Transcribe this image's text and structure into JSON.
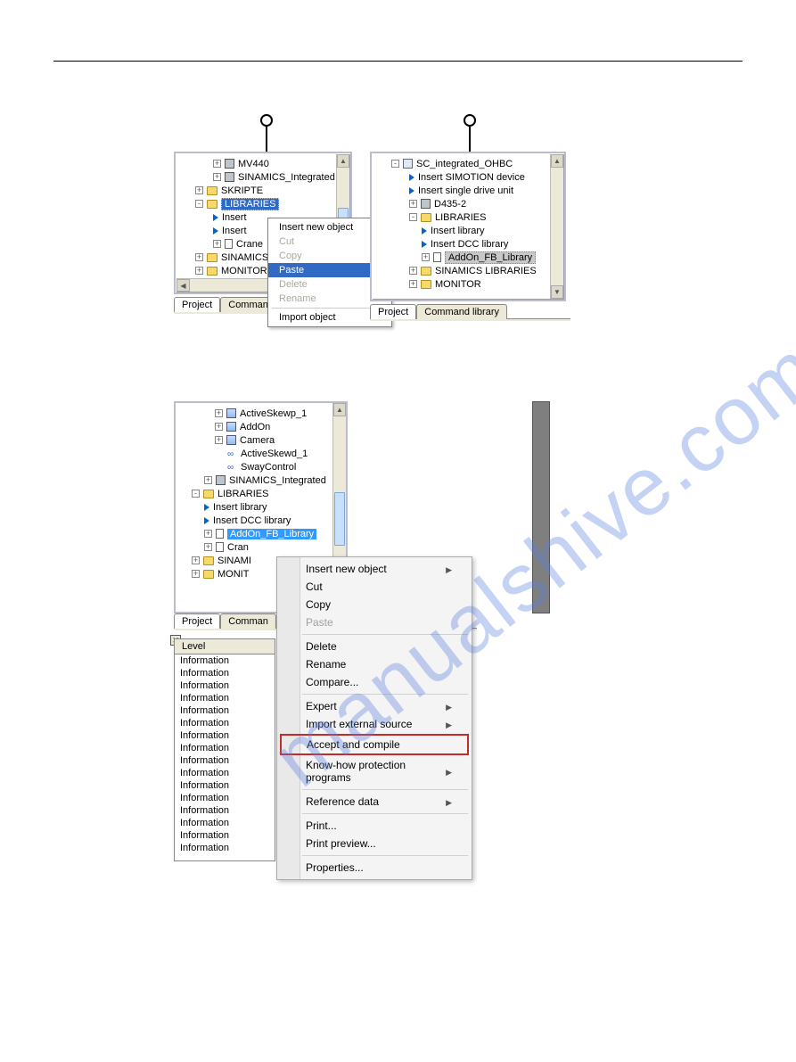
{
  "watermark": "manualshive.com",
  "panelA": {
    "tree": {
      "mv440": "MV440",
      "sinamics_int": "SINAMICS_Integrated",
      "skripte": "SKRIPTE",
      "libraries": "LIBRARIES",
      "insert1": "Insert",
      "insert2": "Insert",
      "crane": "Crane",
      "sinamics": "SINAMICS",
      "monitor": "MONITOR"
    },
    "tabs": {
      "project": "Project",
      "cmdlib": "Command lib"
    },
    "menu": {
      "insert_new": "Insert new object",
      "cut": "Cut",
      "copy": "Copy",
      "paste": "Paste",
      "delete": "Delete",
      "rename": "Rename",
      "import": "Import object"
    }
  },
  "panelB": {
    "tree": {
      "root": "SC_integrated_OHBC",
      "ins_simotion": "Insert SIMOTION device",
      "ins_drive": "Insert single drive unit",
      "d435": "D435-2",
      "libraries": "LIBRARIES",
      "ins_lib": "Insert library",
      "ins_dcc": "Insert DCC library",
      "addon": "AddOn_FB_Library",
      "sinamics_lib": "SINAMICS LIBRARIES",
      "monitor": "MONITOR"
    },
    "tabs": {
      "project": "Project",
      "cmdlib": "Command library"
    }
  },
  "panelC": {
    "tree": {
      "askewp1": "ActiveSkewp_1",
      "addon": "AddOn",
      "camera": "Camera",
      "askewd1": "ActiveSkewd_1",
      "swayc": "SwayControl",
      "sinamics_int": "SINAMICS_Integrated",
      "libraries": "LIBRARIES",
      "ins_lib": "Insert library",
      "ins_dcc": "Insert DCC library",
      "addon_fb": "AddOn_FB_Library",
      "cran": "Cran",
      "sinami": "SINAMI",
      "monit": "MONIT"
    },
    "tabs": {
      "project": "Project",
      "cmdlib": "Comman"
    },
    "info": {
      "header": "Level",
      "row": "Information"
    },
    "menu": {
      "insert_new": "Insert new object",
      "cut": "Cut",
      "copy": "Copy",
      "paste": "Paste",
      "delete": "Delete",
      "rename": "Rename",
      "compare": "Compare...",
      "expert": "Expert",
      "import_ext": "Import external source",
      "accept": "Accept and compile",
      "know_how": "Know-how protection programs",
      "ref_data": "Reference data",
      "print": "Print...",
      "print_pre": "Print preview...",
      "properties": "Properties..."
    }
  }
}
